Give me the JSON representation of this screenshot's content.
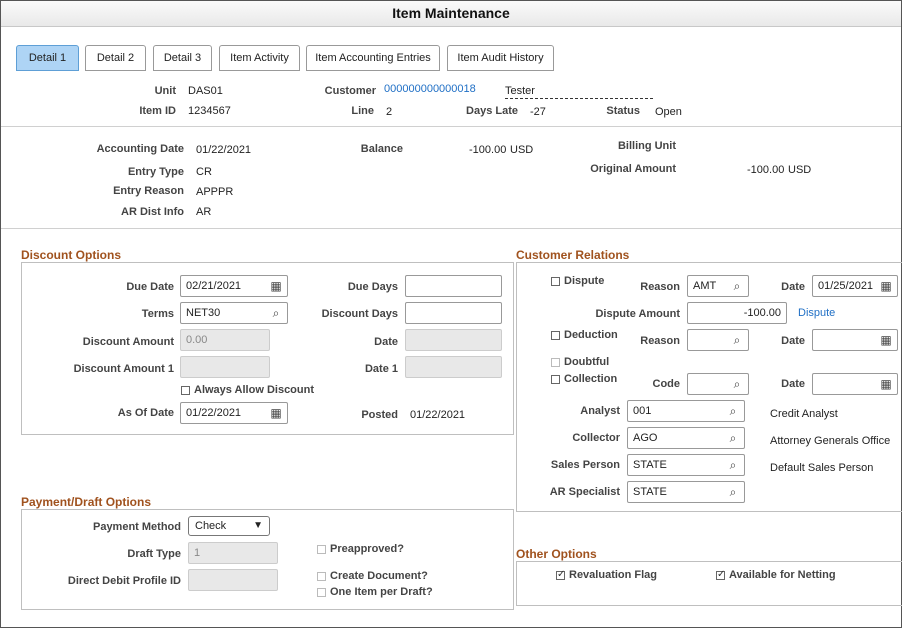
{
  "window": {
    "title": "Item Maintenance"
  },
  "tabs": [
    {
      "label": "Detail 1"
    },
    {
      "label": "Detail 2"
    },
    {
      "label": "Detail 3"
    },
    {
      "label": "Item Activity"
    },
    {
      "label": "Item Accounting Entries"
    },
    {
      "label": "Item Audit History"
    }
  ],
  "header": {
    "unit_label": "Unit",
    "unit_value": "DAS01",
    "customer_label": "Customer",
    "customer_value": "000000000000018",
    "customer_name": "Tester",
    "item_id_label": "Item ID",
    "item_id_value": "1234567",
    "line_label": "Line",
    "line_value": "2",
    "days_late_label": "Days Late",
    "days_late_value": "-27",
    "status_label": "Status",
    "status_value": "Open"
  },
  "summary": {
    "accounting_date_label": "Accounting Date",
    "accounting_date_value": "01/22/2021",
    "balance_label": "Balance",
    "balance_value": "-100.00",
    "balance_currency": "USD",
    "billing_unit_label": "Billing Unit",
    "entry_type_label": "Entry Type",
    "entry_type_value": "CR",
    "original_amount_label": "Original Amount",
    "original_amount_value": "-100.00",
    "original_amount_currency": "USD",
    "entry_reason_label": "Entry Reason",
    "entry_reason_value": "APPPR",
    "ar_dist_label": "AR Dist Info",
    "ar_dist_value": "AR"
  },
  "discount": {
    "title": "Discount Options",
    "due_date_label": "Due Date",
    "due_date_value": "02/21/2021",
    "due_days_label": "Due Days",
    "due_days_value": "",
    "terms_label": "Terms",
    "terms_value": "NET30",
    "discount_days_label": "Discount Days",
    "discount_days_value": "",
    "discount_amount_label": "Discount Amount",
    "discount_amount_value": "0.00",
    "date_label": "Date",
    "date_value": "",
    "discount_amount1_label": "Discount Amount 1",
    "discount_amount1_value": "",
    "date1_label": "Date 1",
    "date1_value": "",
    "always_allow_label": "Always Allow Discount",
    "as_of_date_label": "As Of Date",
    "as_of_date_value": "01/22/2021",
    "posted_label": "Posted",
    "posted_value": "01/22/2021"
  },
  "customer_relations": {
    "title": "Customer Relations",
    "dispute_label": "Dispute",
    "reason_label": "Reason",
    "dispute_reason_value": "AMT",
    "date_label": "Date",
    "dispute_date_value": "01/25/2021",
    "dispute_amount_label": "Dispute Amount",
    "dispute_amount_value": "-100.00",
    "dispute_link": "Dispute",
    "deduction_label": "Deduction",
    "deduction_reason_value": "",
    "deduction_date_value": "",
    "doubtful_label": "Doubtful",
    "collection_label": "Collection",
    "code_label": "Code",
    "code_value": "",
    "collection_date_value": "",
    "analyst_label": "Analyst",
    "analyst_value": "001",
    "analyst_desc": "Credit Analyst",
    "collector_label": "Collector",
    "collector_value": "AGO",
    "collector_desc": "Attorney Generals Office",
    "sales_person_label": "Sales Person",
    "sales_person_value": "STATE",
    "sales_person_desc": "Default Sales Person",
    "ar_specialist_label": "AR Specialist",
    "ar_specialist_value": "STATE"
  },
  "payment": {
    "title": "Payment/Draft Options",
    "payment_method_label": "Payment Method",
    "payment_method_value": "Check",
    "draft_type_label": "Draft Type",
    "draft_type_value": "1",
    "direct_debit_label": "Direct Debit Profile ID",
    "direct_debit_value": "",
    "preapproved_label": "Preapproved?",
    "create_document_label": "Create Document?",
    "one_item_label": "One Item per Draft?"
  },
  "other": {
    "title": "Other Options",
    "revaluation_label": "Revaluation Flag",
    "revaluation_checked": true,
    "netting_label": "Available for Netting",
    "netting_checked": true
  },
  "icons": {
    "calendar": "calendar-icon",
    "search": "search-icon",
    "dropdown": "chevron-down-icon"
  },
  "colors": {
    "active_tab": "#aed4f5",
    "section_title": "#a0521e",
    "link": "#1f6fc5"
  }
}
